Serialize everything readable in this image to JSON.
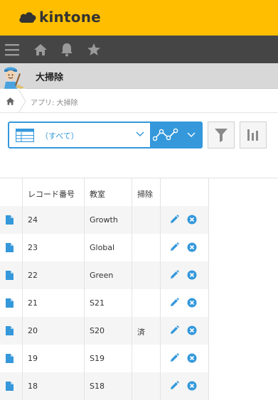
{
  "brand": {
    "logo_text": "kintone",
    "color": "#ffbe00"
  },
  "nav": {
    "icons": [
      "menu-icon",
      "home-icon",
      "bell-icon",
      "star-icon"
    ]
  },
  "app": {
    "title": "大掃除"
  },
  "breadcrumb": {
    "text": "アプリ: 大掃除"
  },
  "toolbar": {
    "view_label": "（すべて）",
    "accent": "#3498db",
    "icons": [
      "list-view-icon",
      "chevron-down-icon",
      "graph-icon",
      "filter-icon",
      "bar-chart-icon"
    ]
  },
  "table": {
    "columns": [
      "",
      "レコード番号",
      "教室",
      "掃除",
      ""
    ],
    "rows": [
      {
        "id": "24",
        "room": "Growth",
        "cleaned": ""
      },
      {
        "id": "23",
        "room": "Global",
        "cleaned": ""
      },
      {
        "id": "22",
        "room": "Green",
        "cleaned": ""
      },
      {
        "id": "21",
        "room": "S21",
        "cleaned": ""
      },
      {
        "id": "20",
        "room": "S20",
        "cleaned": "済"
      },
      {
        "id": "19",
        "room": "S19",
        "cleaned": ""
      },
      {
        "id": "18",
        "room": "S18",
        "cleaned": ""
      }
    ]
  }
}
